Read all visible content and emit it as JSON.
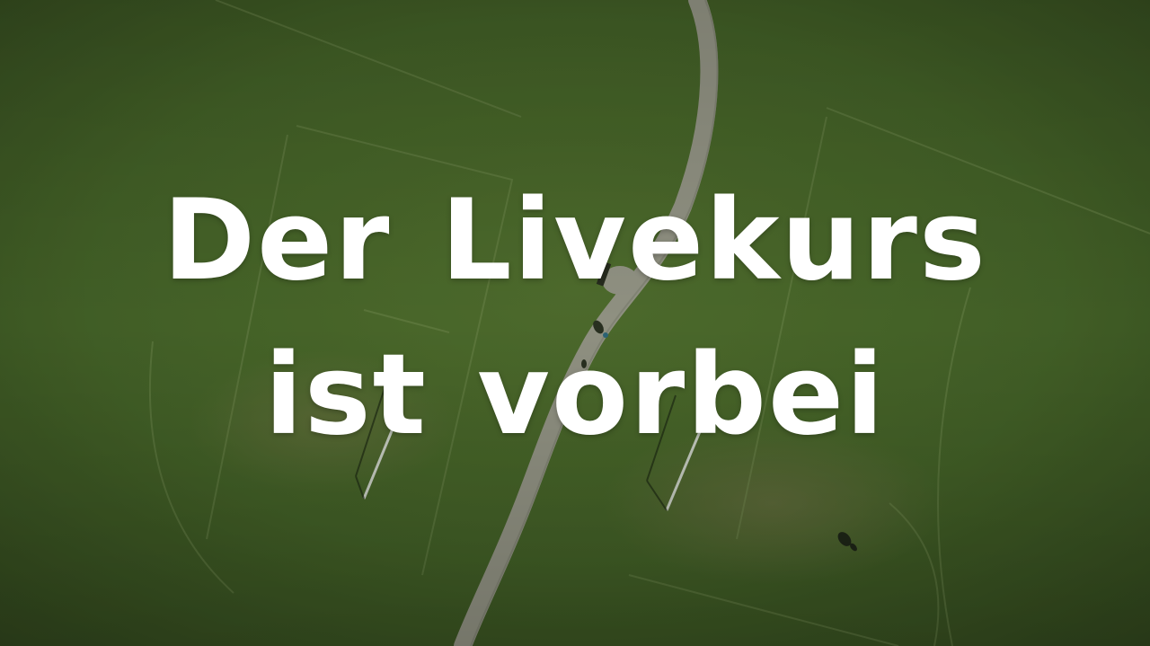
{
  "headline": {
    "line1": "Der Livekurs",
    "line2": "ist vorbei"
  },
  "colors": {
    "grass_dark": "#3f5a26",
    "grass_mid": "#4d6b2c",
    "grass_light": "#5c7a35",
    "path": "#a9a79a",
    "text": "#ffffff"
  }
}
